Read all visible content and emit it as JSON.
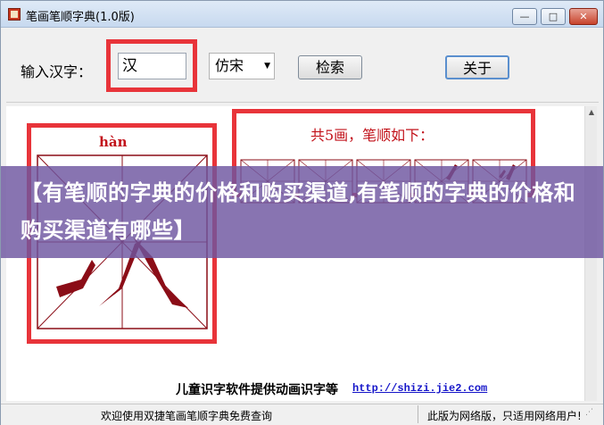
{
  "window": {
    "title": "笔画笔顺字典(1.0版)",
    "min_glyph": "—",
    "max_glyph": "□",
    "close_glyph": "✕",
    "app_icon": "book-icon"
  },
  "toolbar": {
    "input_label": "输入汉字：",
    "input_value": "汉",
    "font_selected": "仿宋",
    "search_label": "检索",
    "about_label": "关于"
  },
  "character": {
    "pinyin": "hàn"
  },
  "strokes": {
    "title": "共5画，笔顺如下："
  },
  "banner": {
    "text": "【有笔顺的字典的价格和购买渠道,有笔顺的字典的价格和购买渠道有哪些】"
  },
  "footer": {
    "text": "儿童识字软件提供动画识字等",
    "link": "http://shizi.jie2.com"
  },
  "status": {
    "left": "欢迎使用双捷笔画笔顺字典免费查询",
    "right": "此版为网络版，只适用网络用户!"
  },
  "colors": {
    "highlight": "#e8343a",
    "stroke": "#8b0d17",
    "pinyin": "#c2131b",
    "banner": "#6e55a0"
  }
}
